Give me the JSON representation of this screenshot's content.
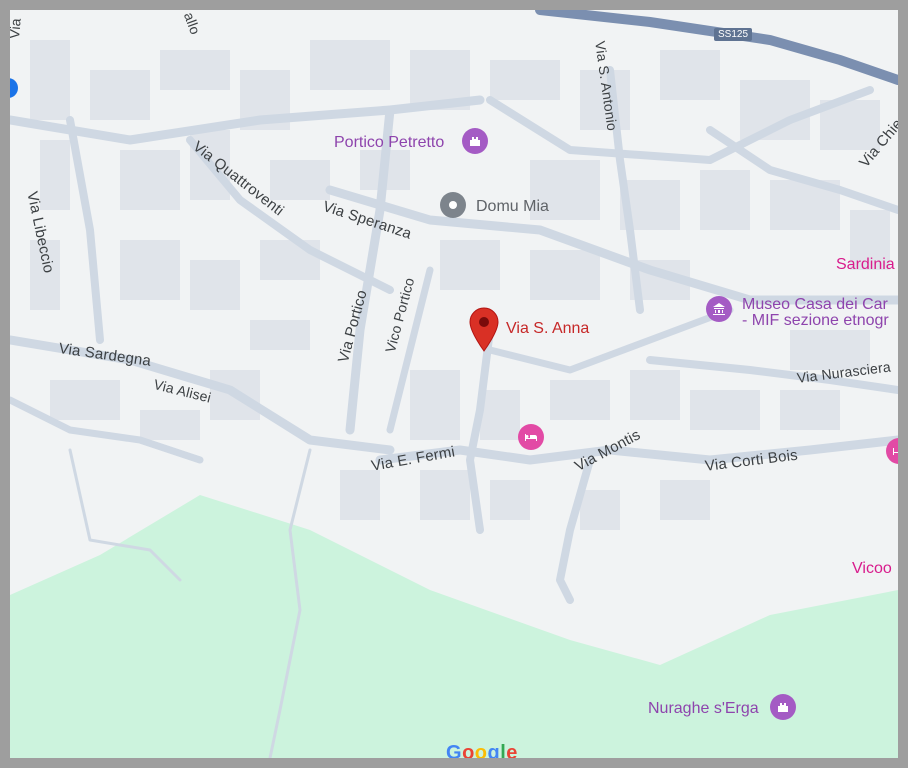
{
  "highway": {
    "shield": "SS125"
  },
  "streets": {
    "via_libeccio": "Via Libeccio",
    "via_quattroventi": "Via Quattroventi",
    "via_speranza": "Via Speranza",
    "via_portico": "Via Portico",
    "vico_portico": "Vico Portico",
    "via_sardegna": "Via Sardegna",
    "via_alisei": "Via Alisei",
    "via_e_fermi": "Via E. Fermi",
    "via_montis": "Via Montis",
    "via_corti_bois": "Via Corti Bois",
    "via_nurasciera": "Via Nurasciera",
    "via_s_antonio": "Via S. Antonio",
    "via_chiesa": "Via Chiesa",
    "top_partial_a": "allo",
    "left_partial": "Via"
  },
  "places": {
    "portico_petretto": "Portico Petretto",
    "domu_mia": "Domu Mia",
    "via_s_anna_pin": "Via S. Anna",
    "sardinia": "Sardinia",
    "museo_line1": "Museo Casa dei Car",
    "museo_line2": "- MIF sezione etnogr",
    "vicoo": "Vicoo",
    "nuraghe_serga": "Nuraghe s'Erga"
  },
  "branding": {
    "logo_letters": [
      "G",
      "o",
      "o",
      "g",
      "l",
      "e"
    ],
    "logo_colors": [
      "#4285f4",
      "#ea4335",
      "#fbbc05",
      "#4285f4",
      "#34a853",
      "#ea4335"
    ]
  },
  "colors": {
    "park": "#ccf3dd",
    "road": "#cfd8e3",
    "building": "#e2e5ea",
    "highway": "#7b8fb0",
    "poi_purple": "#9b59b6",
    "poi_pink": "#d81b8c",
    "pin": "#d93025"
  },
  "icons": {
    "museum": "museum-icon",
    "landmark": "landmark-icon",
    "hotel": "hotel-bed-icon",
    "generic": "place-dot-icon",
    "pin": "location-pin-icon"
  }
}
